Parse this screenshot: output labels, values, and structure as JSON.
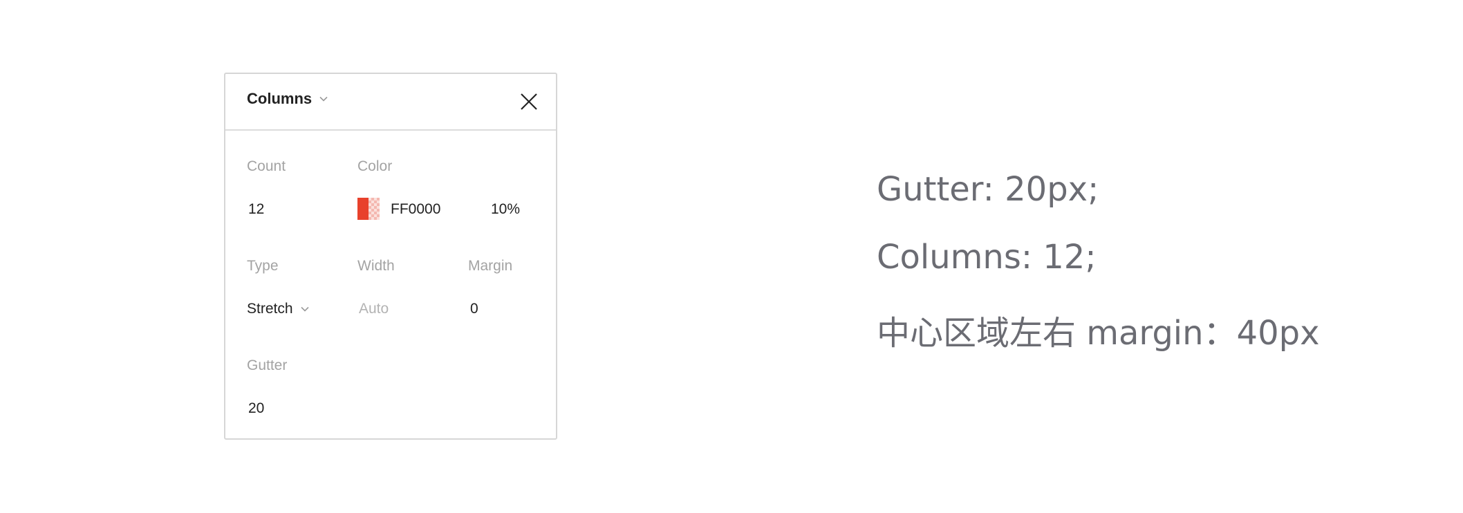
{
  "panel": {
    "title": "Columns",
    "count": {
      "label": "Count",
      "value": "12"
    },
    "color": {
      "label": "Color",
      "hex": "FF0000",
      "opacity": "10%",
      "swatch_color": "#e8412c"
    },
    "type": {
      "label": "Type",
      "value": "Stretch"
    },
    "width": {
      "label": "Width",
      "placeholder": "Auto"
    },
    "margin": {
      "label": "Margin",
      "value": "0"
    },
    "gutter": {
      "label": "Gutter",
      "value": "20"
    }
  },
  "notes": {
    "line1": "Gutter: 20px;",
    "line2": "Columns: 12;",
    "line3": "中心区域左右 margin：40px"
  },
  "icons": {
    "title_dropdown": "chevron-down-icon",
    "close": "close-icon",
    "type_dropdown": "chevron-down-icon"
  }
}
